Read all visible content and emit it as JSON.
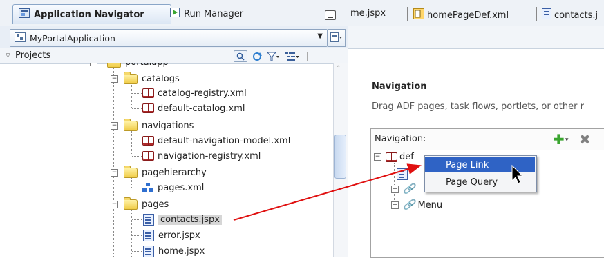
{
  "left_panel": {
    "tabs": [
      {
        "label": "Application Navigator",
        "active": true,
        "icon": "app-navigator-icon"
      },
      {
        "label": "Run Manager",
        "active": false,
        "icon": "run-icon"
      }
    ],
    "app_selector": {
      "value": "MyPortalApplication",
      "icon": "application-icon"
    },
    "projects_label": "Projects",
    "tree": {
      "root_partial": "portalapp",
      "nodes": [
        {
          "label": "catalogs",
          "type": "folder"
        },
        {
          "label": "catalog-registry.xml",
          "type": "xml"
        },
        {
          "label": "default-catalog.xml",
          "type": "xml"
        },
        {
          "label": "navigations",
          "type": "folder"
        },
        {
          "label": "default-navigation-model.xml",
          "type": "xml"
        },
        {
          "label": "navigation-registry.xml",
          "type": "xml"
        },
        {
          "label": "pagehierarchy",
          "type": "folder"
        },
        {
          "label": "pages.xml",
          "type": "hierarchy"
        },
        {
          "label": "pages",
          "type": "folder"
        },
        {
          "label": "contacts.jspx",
          "type": "page",
          "selected": true
        },
        {
          "label": "error.jspx",
          "type": "page"
        },
        {
          "label": "home.jspx",
          "type": "page"
        }
      ]
    }
  },
  "right_panel": {
    "tabs": [
      {
        "label": "me.jspx"
      },
      {
        "label": "homePageDef.xml"
      },
      {
        "label": "contacts.j"
      }
    ],
    "heading": "Navigation",
    "description": "Drag ADF pages, task flows, portlets, or other r",
    "nav_box": {
      "label": "Navigation:",
      "add_symbol": "✚",
      "dropdown_symbol": "▾",
      "delete_symbol": "✖",
      "root_label_partial": "def",
      "menu_label": "Menu"
    },
    "context_menu": {
      "items": [
        {
          "label": "Page Link",
          "highlighted": true
        },
        {
          "label": "Page Query",
          "highlighted": false
        }
      ]
    }
  },
  "colors": {
    "arrow": "#e01010",
    "menu_highlight": "#2f63c5",
    "add_green": "#3aa52f"
  }
}
